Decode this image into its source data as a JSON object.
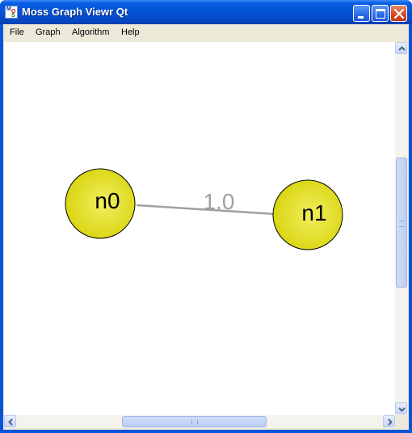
{
  "window": {
    "title": "Moss Graph Viewr Qt",
    "icon": "moss-app-icon"
  },
  "title_buttons": [
    "minimize-icon",
    "maximize-icon",
    "close-icon"
  ],
  "menu": {
    "items": [
      {
        "label": "File"
      },
      {
        "label": "Graph"
      },
      {
        "label": "Algorithm"
      },
      {
        "label": "Help"
      }
    ]
  },
  "graph": {
    "nodes": [
      {
        "id": "n0",
        "label": "n0"
      },
      {
        "id": "n1",
        "label": "n1"
      }
    ],
    "edges": [
      {
        "source": "n0",
        "target": "n1",
        "weight_label": "1.0"
      }
    ],
    "colors": {
      "node_fill": "#e6e21e",
      "node_highlight": "#f2ee60",
      "node_stroke": "#000000",
      "edge": "#a0a0a0",
      "edge_label": "#a0a0a0"
    }
  },
  "scrollbars": {
    "vertical": {
      "position_fraction": 0.31
    },
    "horizontal": {
      "position_fraction": 0.33
    }
  }
}
